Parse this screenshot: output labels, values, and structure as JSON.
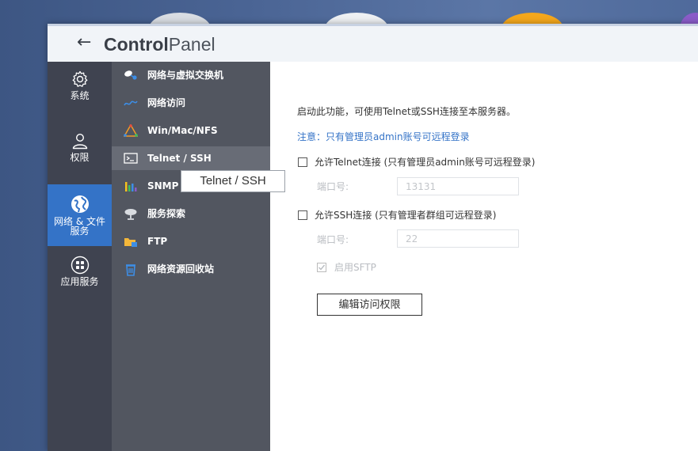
{
  "window": {
    "back_glyph": "←",
    "title_bold": "Control",
    "title_light": "Panel"
  },
  "left_nav": [
    {
      "label": "系统",
      "icon": "gear-icon"
    },
    {
      "label": "权限",
      "icon": "user-icon"
    },
    {
      "label_line1": "网络 & 文件",
      "label_line2": "服务",
      "icon": "globe-icon"
    },
    {
      "label": "应用服务",
      "icon": "grid-icon"
    }
  ],
  "sub_nav": [
    {
      "label": "网络与虚拟交换机",
      "icon": "network-switch-icon"
    },
    {
      "label": "网络访问",
      "icon": "network-access-icon"
    },
    {
      "label": "Win/Mac/NFS",
      "icon": "win-mac-nfs-icon"
    },
    {
      "label": "Telnet / SSH",
      "icon": "terminal-icon"
    },
    {
      "label": "SNMP",
      "icon": "bar-chart-icon"
    },
    {
      "label": "服务探索",
      "icon": "satellite-dish-icon"
    },
    {
      "label": "FTP",
      "icon": "ftp-folder-icon"
    },
    {
      "label": "网络资源回收站",
      "icon": "recycle-bin-icon"
    }
  ],
  "tooltip": "Telnet / SSH",
  "content": {
    "intro": "启动此功能，可使用Telnet或SSH连接至本服务器。",
    "note_label": "注意：",
    "note_text": "只有管理员admin账号可远程登录",
    "telnet_checkbox_label": "允许Telnet连接 (只有管理员admin账号可远程登录)",
    "telnet_port_label": "端口号:",
    "telnet_port_value": "13131",
    "ssh_checkbox_label": "允许SSH连接 (只有管理者群组可远程登录)",
    "ssh_port_label": "端口号:",
    "ssh_port_value": "22",
    "sftp_label": "启用SFTP",
    "edit_button": "编辑访问权限"
  },
  "colors": {
    "accent": "#3473c7",
    "left_bar": "#3f4350",
    "sub_bar": "#525660"
  }
}
